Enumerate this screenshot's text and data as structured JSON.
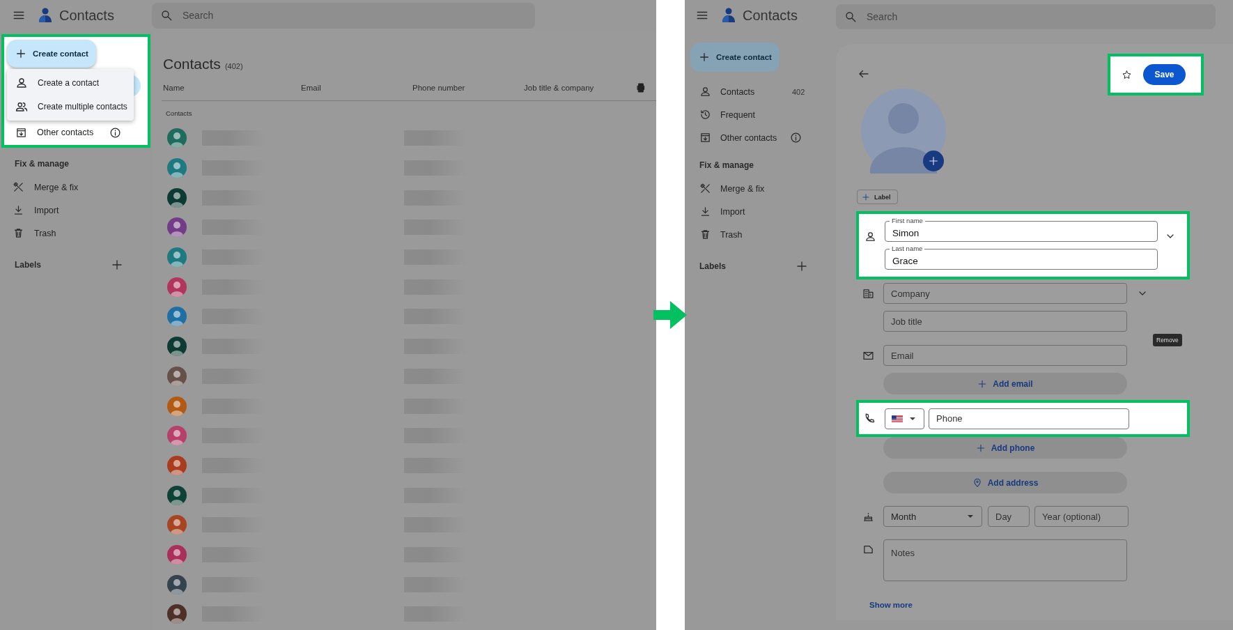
{
  "left_screen": {
    "header": {
      "app_title": "Contacts",
      "search": {
        "placeholder": "Search"
      }
    },
    "sidebar": {
      "create_button": "Create contact",
      "create_menu": [
        {
          "label": "Create a contact",
          "kind": "person"
        },
        {
          "label": "Create multiple contacts",
          "kind": "people"
        }
      ],
      "items": [
        {
          "label": "Other contacts",
          "kind": "archive",
          "info": true
        }
      ],
      "fix_heading": "Fix & manage",
      "fix_items": [
        {
          "label": "Merge & fix",
          "kind": "tools",
          "info": false
        },
        {
          "label": "Import",
          "kind": "download",
          "info": false
        },
        {
          "label": "Trash",
          "kind": "trash",
          "info": false
        }
      ],
      "labels_heading": "Labels"
    },
    "list": {
      "title": "Contacts",
      "count": "(402)",
      "columns": [
        "Name",
        "Email",
        "Phone number",
        "Job title & company"
      ],
      "section": "Contacts",
      "rows": [
        {
          "color": "#1f6b5e"
        },
        {
          "color": "#1d7a80"
        },
        {
          "color": "#0d3b33"
        },
        {
          "color": "#723d86"
        },
        {
          "color": "#1d7a80"
        },
        {
          "color": "#b0365e"
        },
        {
          "color": "#1f6fa3"
        },
        {
          "color": "#0d3b33"
        },
        {
          "color": "#65504a"
        },
        {
          "color": "#b35a12"
        },
        {
          "color": "#b5406a"
        },
        {
          "color": "#a83c1c"
        },
        {
          "color": "#0f4236"
        },
        {
          "color": "#a84422"
        },
        {
          "color": "#a8305a"
        },
        {
          "color": "#34434d"
        },
        {
          "color": "#4d3028"
        }
      ]
    }
  },
  "right_screen": {
    "header": {
      "app_title": "Contacts",
      "search": {
        "placeholder": "Search"
      }
    },
    "sidebar": {
      "create_button": "Create contact",
      "items": [
        {
          "label": "Contacts",
          "kind": "person",
          "count": "402",
          "info": false
        },
        {
          "label": "Frequent",
          "kind": "history",
          "info": false
        },
        {
          "label": "Other contacts",
          "kind": "archive",
          "info": true
        }
      ],
      "fix_heading": "Fix & manage",
      "fix_items": [
        {
          "label": "Merge & fix",
          "kind": "tools",
          "info": false
        },
        {
          "label": "Import",
          "kind": "download",
          "info": false
        },
        {
          "label": "Trash",
          "kind": "trash",
          "info": false
        }
      ],
      "labels_heading": "Labels"
    },
    "form": {
      "save": "Save",
      "label_button": "Label",
      "first_name": {
        "label": "First name",
        "value": "Simon"
      },
      "last_name": {
        "label": "Last name",
        "value": "Grace"
      },
      "company": {
        "placeholder": "Company"
      },
      "job_title": {
        "placeholder": "Job title"
      },
      "tooltip": "Remove",
      "email": {
        "placeholder": "Email"
      },
      "add_email": "Add email",
      "phone": {
        "placeholder": "Phone"
      },
      "add_phone": "Add phone",
      "add_address": "Add address",
      "birthday": {
        "month": "Month",
        "day": {
          "placeholder": "Day"
        },
        "year": {
          "placeholder": "Year (optional)"
        }
      },
      "notes": {
        "placeholder": "Notes"
      },
      "show_more": "Show more"
    }
  }
}
